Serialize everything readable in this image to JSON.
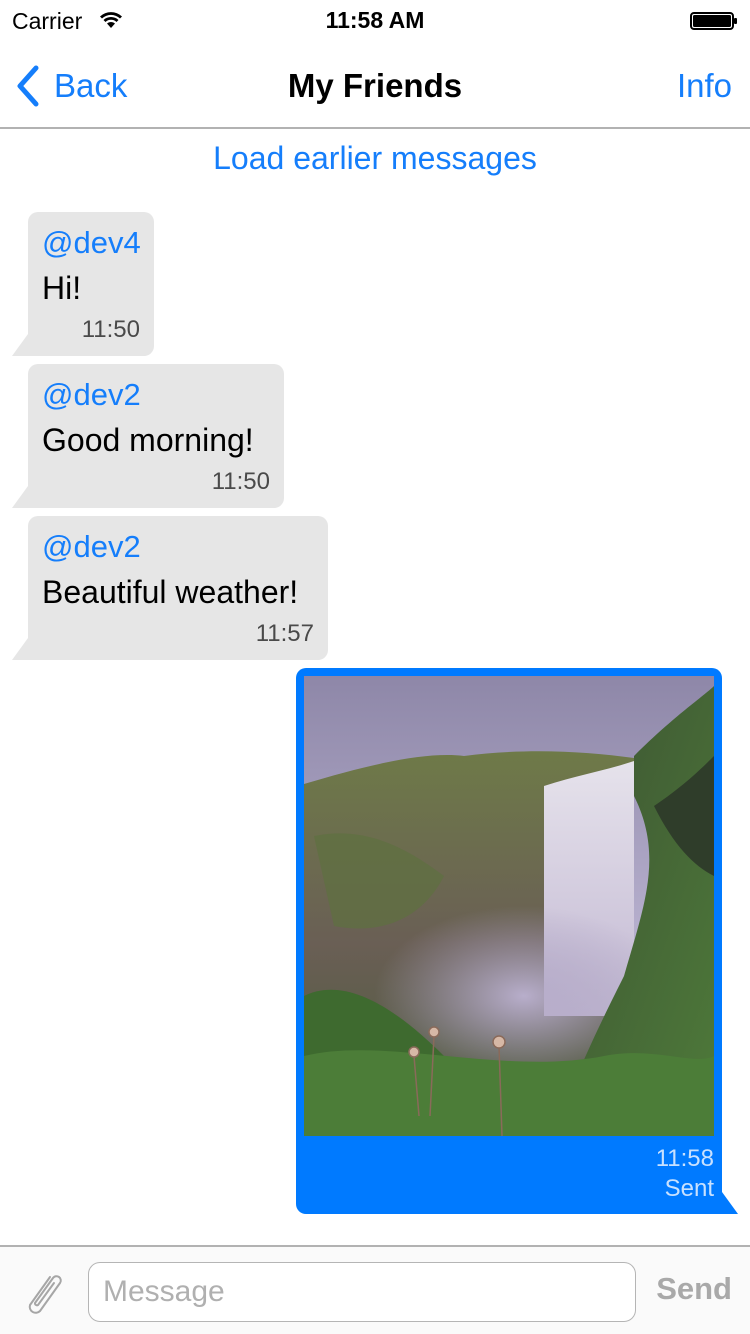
{
  "status_bar": {
    "carrier": "Carrier",
    "time": "11:58 AM",
    "wifi_icon": "wifi-icon",
    "battery_icon": "battery-full-icon"
  },
  "nav": {
    "back_label": "Back",
    "title": "My Friends",
    "info_label": "Info",
    "accent_color": "#157efb"
  },
  "load_earlier_label": "Load earlier messages",
  "messages": [
    {
      "sender": "@dev4",
      "text": "Hi!",
      "time": "11:50",
      "direction": "incoming"
    },
    {
      "sender": "@dev2",
      "text": "Good morning!",
      "time": "11:50",
      "direction": "incoming"
    },
    {
      "sender": "@dev2",
      "text": "Beautiful weather!",
      "time": "11:57",
      "direction": "incoming"
    },
    {
      "type": "photo",
      "photo_description": "Waterfall cascading over a green mossy cliff under a cloudy purple sky",
      "time": "11:58",
      "status": "Sent",
      "direction": "outgoing",
      "bubble_color": "#007aff"
    }
  ],
  "input_bar": {
    "attach_icon": "paperclip-icon",
    "message_value": "",
    "message_placeholder": "Message",
    "send_label": "Send"
  }
}
